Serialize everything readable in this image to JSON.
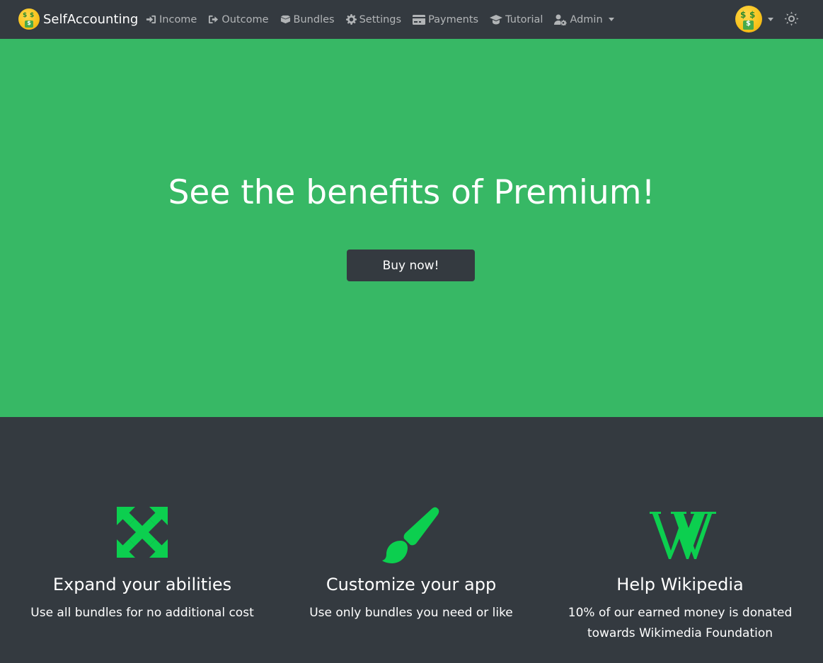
{
  "navbar": {
    "brand": "SelfAccounting",
    "items": [
      {
        "label": "Income",
        "icon": "sign-in-icon"
      },
      {
        "label": "Outcome",
        "icon": "sign-out-icon"
      },
      {
        "label": "Bundles",
        "icon": "boxes-icon"
      },
      {
        "label": "Settings",
        "icon": "gear-icon"
      },
      {
        "label": "Payments",
        "icon": "credit-card-icon"
      },
      {
        "label": "Tutorial",
        "icon": "graduation-cap-icon"
      },
      {
        "label": "Admin",
        "icon": "user-cog-icon"
      }
    ],
    "user_avatar": "money-mouth-face-emoji",
    "theme_toggle_icon": "sun-icon"
  },
  "hero": {
    "title": "See the benefits of Premium!",
    "button_label": "Buy now!",
    "background_color": "#37b865"
  },
  "features": [
    {
      "icon": "expand-arrows-icon",
      "title": "Expand your abilities",
      "text": "Use all bundles for no additional cost"
    },
    {
      "icon": "paint-brush-icon",
      "title": "Customize your app",
      "text": "Use only bundles you need or like"
    },
    {
      "icon": "wikipedia-icon",
      "title": "Help Wikipedia",
      "text": "10% of our earned money is donated towards Wikimedia Foundation"
    }
  ],
  "colors": {
    "dark": "#343a40",
    "accent_green": "#0ccf4f",
    "nav_text": "rgba(255,255,255,0.62)"
  }
}
